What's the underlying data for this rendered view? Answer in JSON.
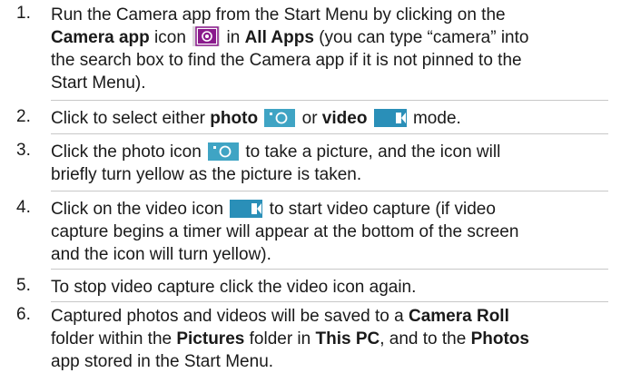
{
  "steps": [
    {
      "number": "1.",
      "lines": {
        "l1": "Run the Camera app from the Start Menu by clicking on the",
        "l2_b1": "Camera app",
        "l2_t1": " icon ",
        "l2_t2": " in ",
        "l2_b2": "All Apps",
        "l2_t3": " (you can type “camera” into",
        "l3": "the search box to find the Camera app if it is not pinned to the",
        "l4": "Start Menu)."
      }
    },
    {
      "number": "2.",
      "lines": {
        "t1": "Click to select either ",
        "b1": "photo",
        "t2": " or ",
        "b2": "video",
        "t3": " mode."
      }
    },
    {
      "number": "3.",
      "lines": {
        "l1_a": "Click the photo icon ",
        "l1_b": " to take a picture, and the icon will",
        "l2": "briefly turn yellow as the picture is taken."
      }
    },
    {
      "number": "4.",
      "lines": {
        "l1_a": "Click on the video icon ",
        "l1_b": " to start video capture (if video",
        "l2": "capture begins a timer will appear at the bottom of the screen",
        "l3": "and the icon will turn yellow)."
      }
    },
    {
      "number": "5.",
      "lines": {
        "l1": "To stop video capture click the video icon again."
      }
    },
    {
      "number": "6.",
      "lines": {
        "l1_a": "Captured photos and videos will be saved to a ",
        "l1_b": "Camera Roll",
        "l2_a": "folder within the ",
        "l2_b1": "Pictures",
        "l2_t1": " folder in ",
        "l2_b2": "This PC",
        "l2_t2": ", and to the ",
        "l2_b3": "Photos",
        "l3": "app stored in the Start Menu."
      }
    }
  ],
  "icons": {
    "camera_app": "camera-app-icon",
    "photo": "photo-mode-icon",
    "video": "video-mode-icon"
  },
  "colors": {
    "camera_app_tile": "#8a1a8c",
    "camera_app_bg": "#dcd6dc",
    "mode_tile": "#3fa4c4",
    "video_tile": "#2a8fb8",
    "divider": "#c8c8c8"
  }
}
